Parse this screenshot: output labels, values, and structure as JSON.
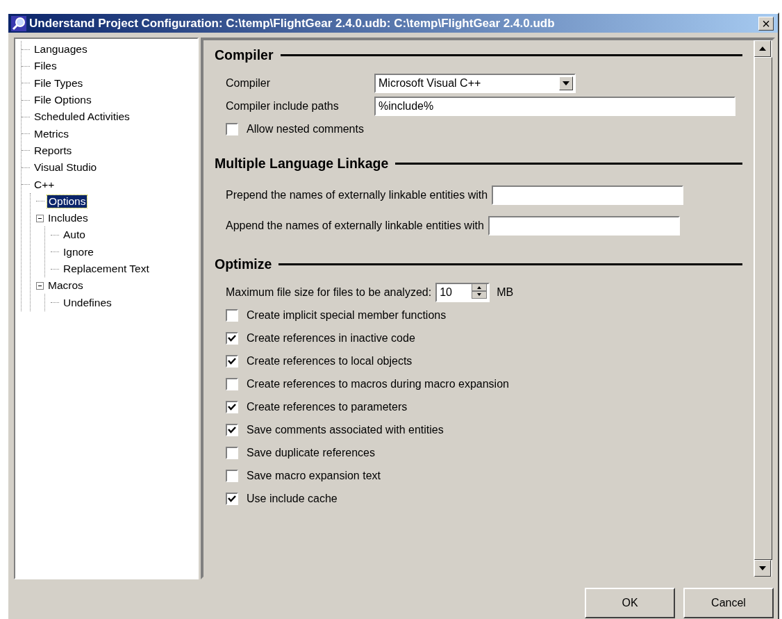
{
  "window": {
    "title": "Understand Project Configuration: C:\\temp\\FlightGear 2.4.0.udb: C:\\temp\\FlightGear 2.4.0.udb",
    "close": "×"
  },
  "tree": [
    {
      "label": "Languages",
      "selected": false
    },
    {
      "label": "Files",
      "selected": false
    },
    {
      "label": "File Types",
      "selected": false
    },
    {
      "label": "File Options",
      "selected": false
    },
    {
      "label": "Scheduled Activities",
      "selected": false
    },
    {
      "label": "Metrics",
      "selected": false
    },
    {
      "label": "Reports",
      "selected": false
    },
    {
      "label": "Visual Studio",
      "selected": false
    },
    {
      "label": "C++",
      "selected": false,
      "children": [
        {
          "label": "Options",
          "selected": true
        },
        {
          "label": "Includes",
          "selected": false,
          "expanded": true,
          "children": [
            {
              "label": "Auto",
              "selected": false
            },
            {
              "label": "Ignore",
              "selected": false
            },
            {
              "label": "Replacement Text",
              "selected": false
            }
          ]
        },
        {
          "label": "Macros",
          "selected": false,
          "expanded": true,
          "children": [
            {
              "label": "Undefines",
              "selected": false
            }
          ]
        }
      ]
    }
  ],
  "sections": [
    {
      "title": "Compiler",
      "rows": [
        {
          "kind": "dropdown",
          "label": "Compiler",
          "value": "Microsoft Visual C++"
        },
        {
          "kind": "text",
          "label": "Compiler include paths",
          "value": "%include%"
        },
        {
          "kind": "checkbox",
          "label": "Allow nested comments",
          "checked": false
        }
      ]
    },
    {
      "title": "Multiple Language Linkage",
      "rows": [
        {
          "kind": "text",
          "label": "Prepend the names of externally linkable entities with"
        },
        {
          "kind": "text",
          "label": "Append the names of externally linkable entities with"
        }
      ]
    },
    {
      "title": "Optimize",
      "rows": [
        {
          "kind": "spinner",
          "label": "Maximum file size for files to be analyzed:",
          "value": "10",
          "unit": "MB"
        },
        {
          "kind": "checkbox",
          "label": "Create implicit special member functions",
          "checked": false
        },
        {
          "kind": "checkbox",
          "label": "Create references in inactive code",
          "checked": true
        },
        {
          "kind": "checkbox",
          "label": "Create references to local objects",
          "checked": true
        },
        {
          "kind": "checkbox",
          "label": "Create references to macros during macro expansion",
          "checked": false
        },
        {
          "kind": "checkbox",
          "label": "Create references to parameters",
          "checked": true
        },
        {
          "kind": "checkbox",
          "label": "Save comments associated with entities",
          "checked": true
        },
        {
          "kind": "checkbox",
          "label": "Save duplicate references",
          "checked": false
        },
        {
          "kind": "checkbox",
          "label": "Save macro expansion text",
          "checked": false
        },
        {
          "kind": "checkbox",
          "label": "Use include cache",
          "checked": true
        }
      ]
    }
  ],
  "buttons": [
    "OK",
    "Cancel"
  ]
}
